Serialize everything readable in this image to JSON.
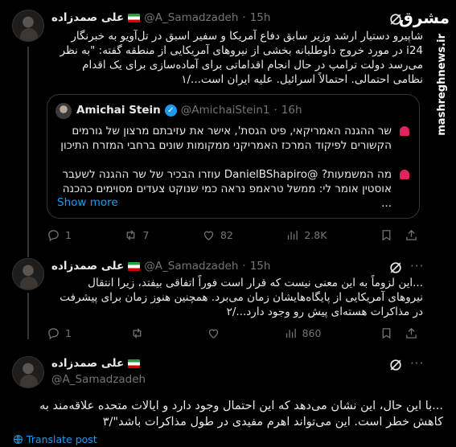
{
  "tweets": [
    {
      "name": "علی صمدزاده",
      "handle": "@A_Samadzadeh",
      "sep": "·",
      "time": "15h",
      "text": "شاپیرو دستیار ارشد وزیر سابق دفاع آمریکا و سفیر اسبق در تل‌آویو به خبرنگار i24 در مورد خروج داوطلبانه بخشی از نیروهای آمریکایی از منطقه گفته: \"به نظر می‌رسد دولت ترامپ در حال انجام اقداماتی برای آماده‌سازی برای یک اقدام نظامی احتمالی. احتمالاً اسرائیل. علیه ایران است.../۱",
      "actions": {
        "replies": "1",
        "reposts": "7",
        "likes": "82",
        "views": "2.8K"
      }
    },
    {
      "name": "علی صمدزاده",
      "handle": "@A_Samadzadeh",
      "sep": "·",
      "time": "15h",
      "text": "...این لزوماً به این معنی نیست که قرار است فوراً اتفاقی بیفتد، زیرا انتقال نیروهای آمریکایی از پایگاه‌هایشان زمان می‌برد. همچنین هنوز زمان برای پیشرفت در مذاکرات هسته‌ای پیش رو وجود دارد.../۲",
      "actions": {
        "replies": "1",
        "reposts": "",
        "likes": "",
        "views": "860"
      }
    },
    {
      "name": "علی صمدزاده",
      "handle": "@A_Samadzadeh",
      "text": "...با این حال، این نشان می‌دهد که این احتمال وجود دارد و ایالات متحده علاقه‌مند به کاهش خطر است. این می‌تواند اهرم مفیدی در طول مذاکرات باشد\"/۳",
      "translate": "Translate post"
    }
  ],
  "quote": {
    "name": "Amichai Stein",
    "handle": "@AmichaiStein1",
    "sep": "·",
    "time": "16h",
    "para1": "שר ההגנה האמריקאי, פיט הגסת', אישר את עזיבתם מרצון של גורמים הקשורים לפיקוד המרכז האמריקני ממקומות שונים ברחבי המזרח התיכון",
    "para2": "מה המשמעות? @DanielBShapiro עוזרו הבכיר של שר ההגנה לשעבר אוסטין אומר לי: ממשל טראמפ נראה כמי שנוקט צעדים מסוימים כהכנה ...",
    "show_more": "Show more"
  },
  "watermark": {
    "logo": "مشرق",
    "site": "mashreghnews.ir"
  },
  "icons": {
    "reply": "reply-icon",
    "repost": "repost-icon",
    "like": "like-icon",
    "views": "views-icon",
    "bookmark": "bookmark-icon",
    "share": "share-icon",
    "grok": "grok-icon",
    "more": "more-icon",
    "globe": "globe-icon"
  },
  "colors": {
    "background": "#000000",
    "text": "#e7e9ea",
    "muted": "#71767b",
    "accent": "#1d9bf0",
    "border": "#2f3336"
  }
}
